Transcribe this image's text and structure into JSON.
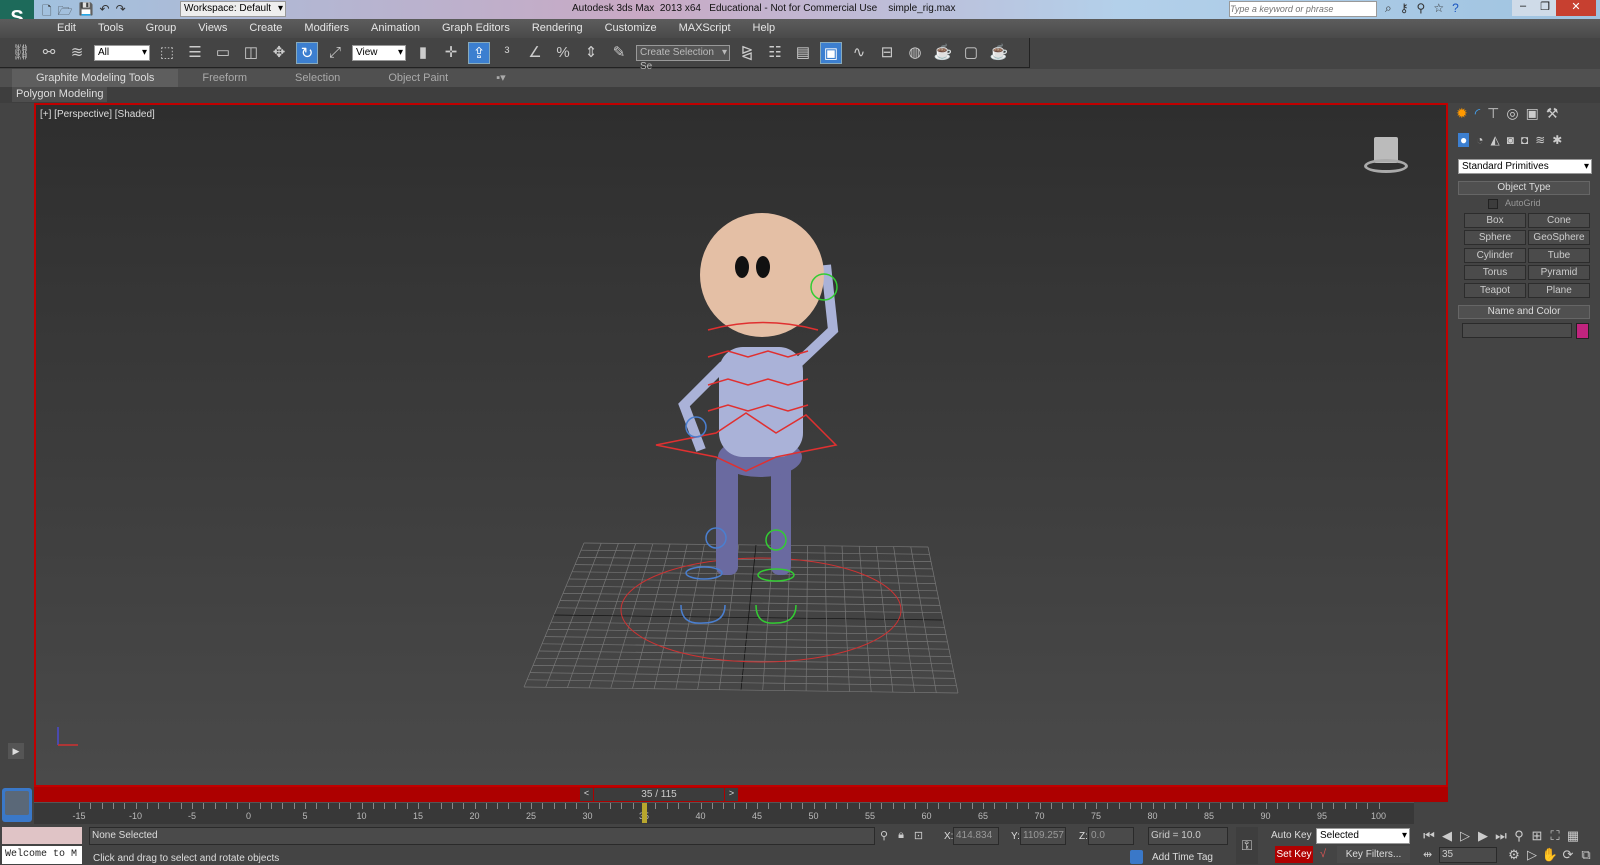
{
  "titlebar": {
    "workspace": "Workspace: Default",
    "title": "Autodesk 3ds Max  2013 x64   Educational - Not for Commercial Use    simple_rig.max",
    "search_placeholder": "Type a keyword or phrase"
  },
  "menu": [
    "Edit",
    "Tools",
    "Group",
    "Views",
    "Create",
    "Modifiers",
    "Animation",
    "Graph Editors",
    "Rendering",
    "Customize",
    "MAXScript",
    "Help"
  ],
  "toolbar": {
    "selection_filter": "All",
    "ref_coord": "View",
    "selection_set": "Create Selection Se"
  },
  "ribbon": {
    "tabs": [
      "Graphite Modeling Tools",
      "Freeform",
      "Selection",
      "Object Paint"
    ],
    "panel": "Polygon Modeling"
  },
  "viewport": {
    "label": "[+] [Perspective] [Shaded]"
  },
  "command_panel": {
    "category": "Standard Primitives",
    "object_type_title": "Object Type",
    "autogrid": "AutoGrid",
    "buttons": [
      "Box",
      "Cone",
      "Sphere",
      "GeoSphere",
      "Cylinder",
      "Tube",
      "Torus",
      "Pyramid",
      "Teapot",
      "Plane"
    ],
    "name_color_title": "Name and Color",
    "object_color": "#c0247e"
  },
  "timeline": {
    "slider": "35 / 115",
    "current_frame": 35,
    "ticks": [
      "-15",
      "-10",
      "-5",
      "0",
      "5",
      "10",
      "15",
      "20",
      "25",
      "30",
      "35",
      "40",
      "45",
      "50",
      "55",
      "60",
      "65",
      "70",
      "75",
      "80",
      "85",
      "90",
      "95",
      "100"
    ]
  },
  "status": {
    "listener": "Welcome to M",
    "selection": "None Selected",
    "prompt": "Click and drag to select and rotate objects",
    "x_label": "X:",
    "x": "414.834",
    "y_label": "Y:",
    "y": "1109.257",
    "z_label": "Z:",
    "z": "0.0",
    "grid": "Grid = 10.0",
    "add_time_tag": "Add Time Tag",
    "auto_key": "Auto Key",
    "set_key": "Set Key",
    "key_mode": "Selected",
    "key_filters": "Key Filters...",
    "frame": "35"
  }
}
